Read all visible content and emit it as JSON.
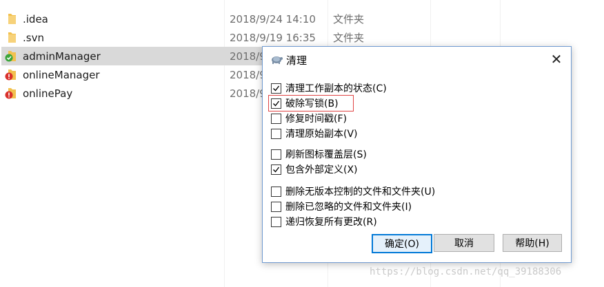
{
  "files": [
    {
      "name": ".idea",
      "date": "2018/9/24 14:10",
      "type": "文件夹",
      "icon": "folder-icon"
    },
    {
      "name": ".svn",
      "date": "2018/9/19 16:35",
      "type": "文件夹",
      "icon": "folder-icon"
    },
    {
      "name": "adminManager",
      "date": "2018/9",
      "type": "",
      "icon": "svn-normal-folder-icon",
      "selected": true
    },
    {
      "name": "onlineManager",
      "date": "2018/9",
      "type": "",
      "icon": "svn-modified-folder-icon"
    },
    {
      "name": "onlinePay",
      "date": "2018/9",
      "type": "",
      "icon": "svn-modified-folder-icon"
    }
  ],
  "dialog": {
    "title": "清理",
    "title_icon": "tortoisesvn-icon",
    "close_glyph": "✕",
    "options": [
      {
        "label": "清理工作副本的状态(C)",
        "checked": true
      },
      {
        "label": "破除写锁(B)",
        "checked": true
      },
      {
        "label": "修复时间戳(F)",
        "checked": false
      },
      {
        "label": "清理原始副本(V)",
        "checked": false
      },
      {
        "label": "刷新图标覆盖层(S)",
        "checked": false
      },
      {
        "label": "包含外部定义(X)",
        "checked": true
      },
      {
        "label": "删除无版本控制的文件和文件夹(U)",
        "checked": false
      },
      {
        "label": "删除已忽略的文件和文件夹(I)",
        "checked": false
      },
      {
        "label": "递归恢复所有更改(R)",
        "checked": false
      }
    ],
    "buttons": {
      "ok": "确定(O)",
      "cancel": "取消",
      "help": "帮助(H)"
    }
  },
  "watermark": "https://blog.csdn.net/qq_39188306",
  "colors": {
    "selected_row": "#d9d9d9",
    "dialog_border": "#6f9ad1",
    "highlight_box": "#e04343",
    "default_button_border": "#0078d7",
    "folder": "#f2c14e",
    "svn_normal": "#3aa53a",
    "svn_modified": "#d9312b"
  }
}
